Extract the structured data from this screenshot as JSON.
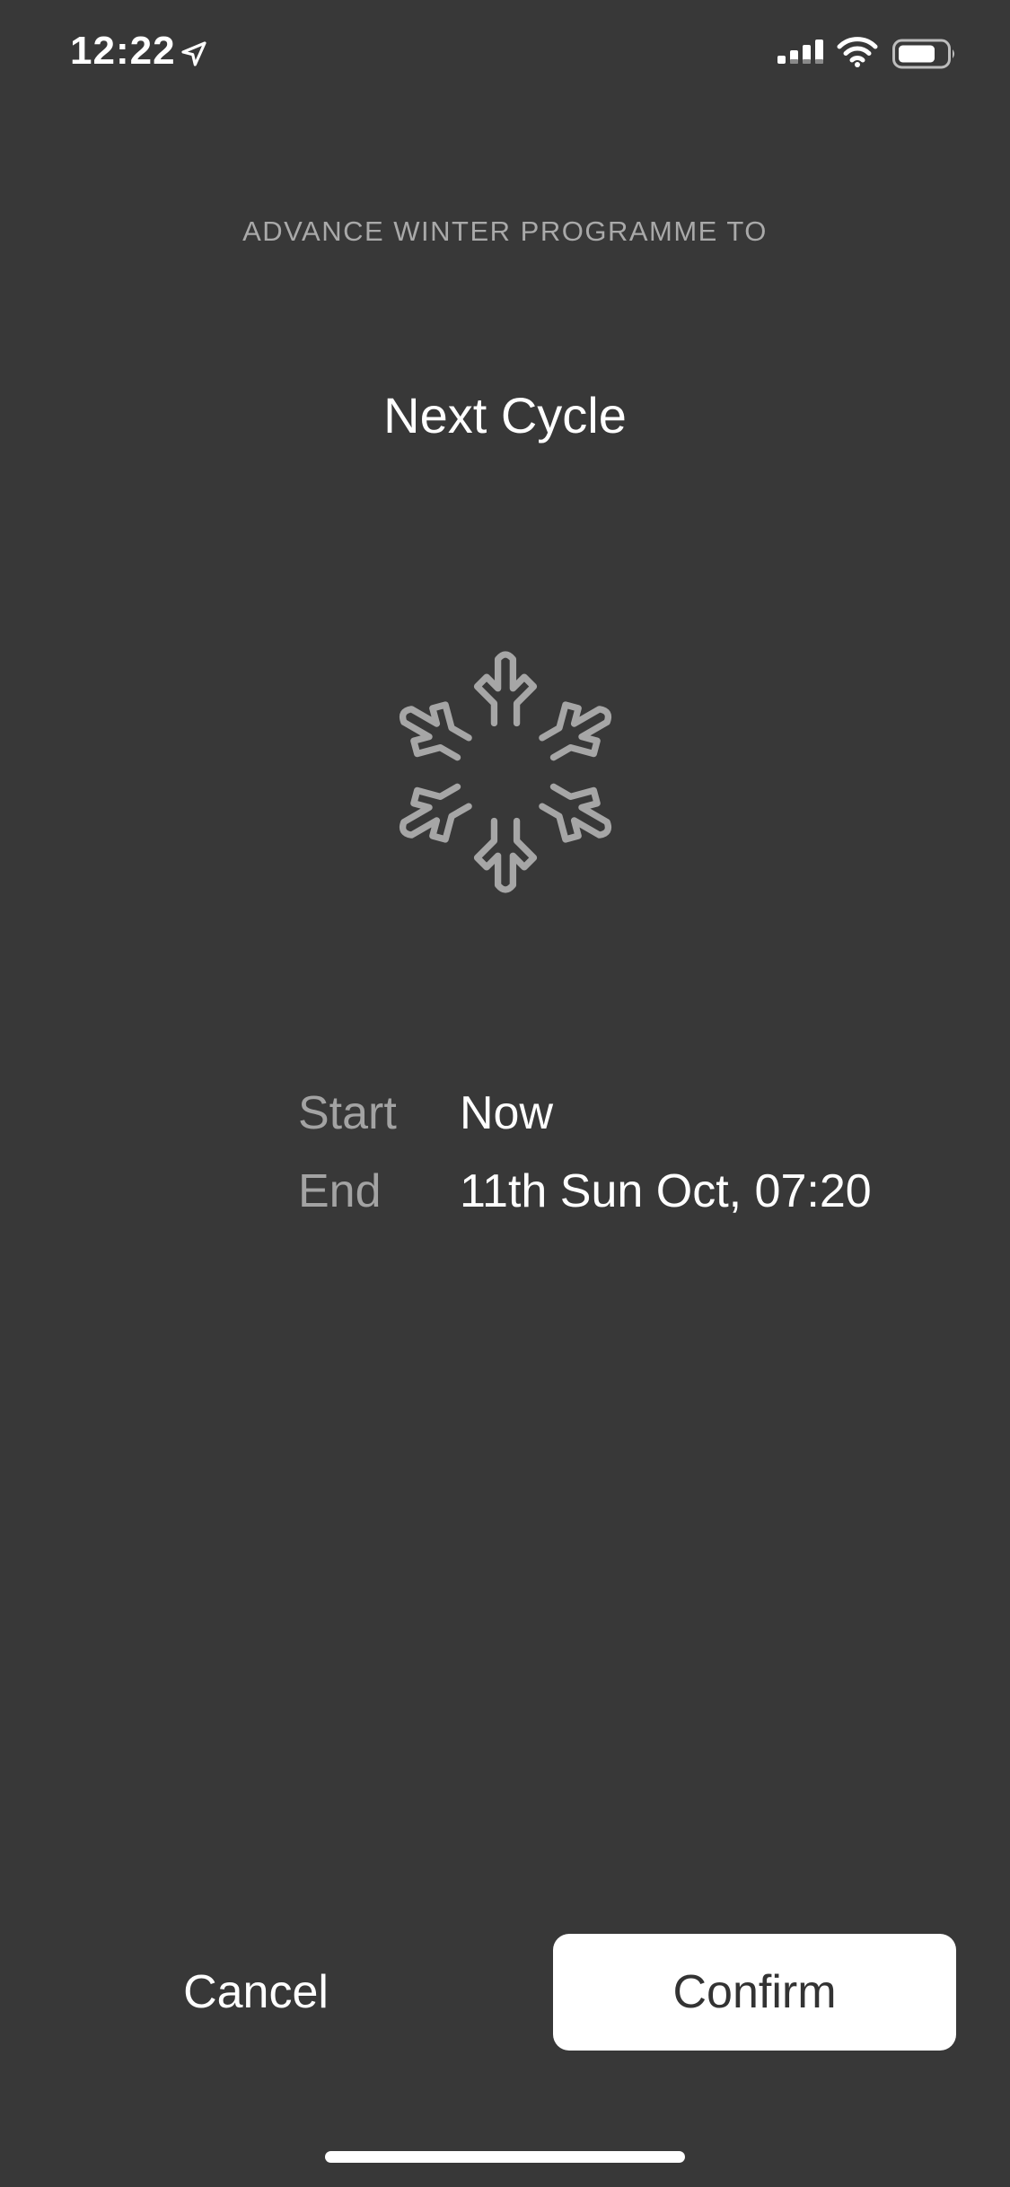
{
  "status_bar": {
    "time": "12:22",
    "icons": [
      "location-arrow-icon",
      "cellular-signal-icon",
      "wifi-icon",
      "battery-icon"
    ]
  },
  "header": {
    "subtitle": "ADVANCE WINTER PROGRAMME TO",
    "title": "Next Cycle"
  },
  "illustration": {
    "icon": "snowflake-icon",
    "stroke_color": "#a6a6a6"
  },
  "schedule": {
    "start_label": "Start",
    "start_value": "Now",
    "end_label": "End",
    "end_value": "11th Sun Oct, 07:20"
  },
  "actions": {
    "cancel_label": "Cancel",
    "confirm_label": "Confirm"
  },
  "colors": {
    "background": "#383838",
    "primary_text": "#ffffff",
    "secondary_text": "#a3a3a3",
    "confirm_button_bg": "#ffffff",
    "confirm_button_text": "#333333"
  }
}
